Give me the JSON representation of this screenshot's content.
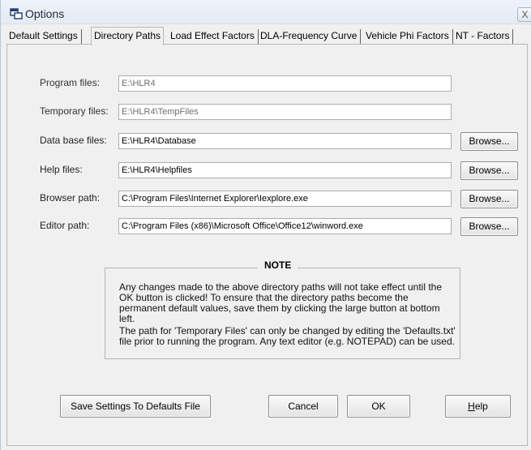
{
  "window": {
    "title": "Options",
    "close_glyph": "X"
  },
  "tabs": [
    {
      "label": "Default Settings"
    },
    {
      "label": "Directory Paths"
    },
    {
      "label": "Load Effect Factors"
    },
    {
      "label": "DLA-Frequency Curve"
    },
    {
      "label": "Vehicle Phi Factors"
    },
    {
      "label": "NT - Factors"
    }
  ],
  "paths": {
    "program": {
      "label": "Program files:",
      "value": "E:\\HLR4"
    },
    "temporary": {
      "label": "Temporary files:",
      "value": "E:\\HLR4\\TempFiles"
    },
    "database": {
      "label": "Data base files:",
      "value": "E:\\HLR4\\Database"
    },
    "help": {
      "label": "Help files:",
      "value": "E:\\HLR4\\Helpfiles"
    },
    "browser": {
      "label": "Browser path:",
      "value": "C:\\Program Files\\Internet Explorer\\Iexplore.exe"
    },
    "editor": {
      "label": "Editor path:",
      "value": "C:\\Program Files (x86)\\Microsoft Office\\Office12\\winword.exe"
    }
  },
  "browse_label": "Browse...",
  "note": {
    "title": "NOTE",
    "paragraph1": "Any changes made to the above directory paths will not take effect until the OK button is clicked!  To ensure that the directory paths become the permanent default values, save them by clicking the large button at bottom left.",
    "paragraph2": "The path for 'Temporary Files' can only be changed by editing the 'Defaults.txt' file prior to running the program.  Any text editor (e.g. NOTEPAD) can be used."
  },
  "buttons": {
    "save_defaults": "Save Settings To Defaults File",
    "cancel": "Cancel",
    "ok": "OK",
    "help_first": "H",
    "help_rest": "elp"
  }
}
